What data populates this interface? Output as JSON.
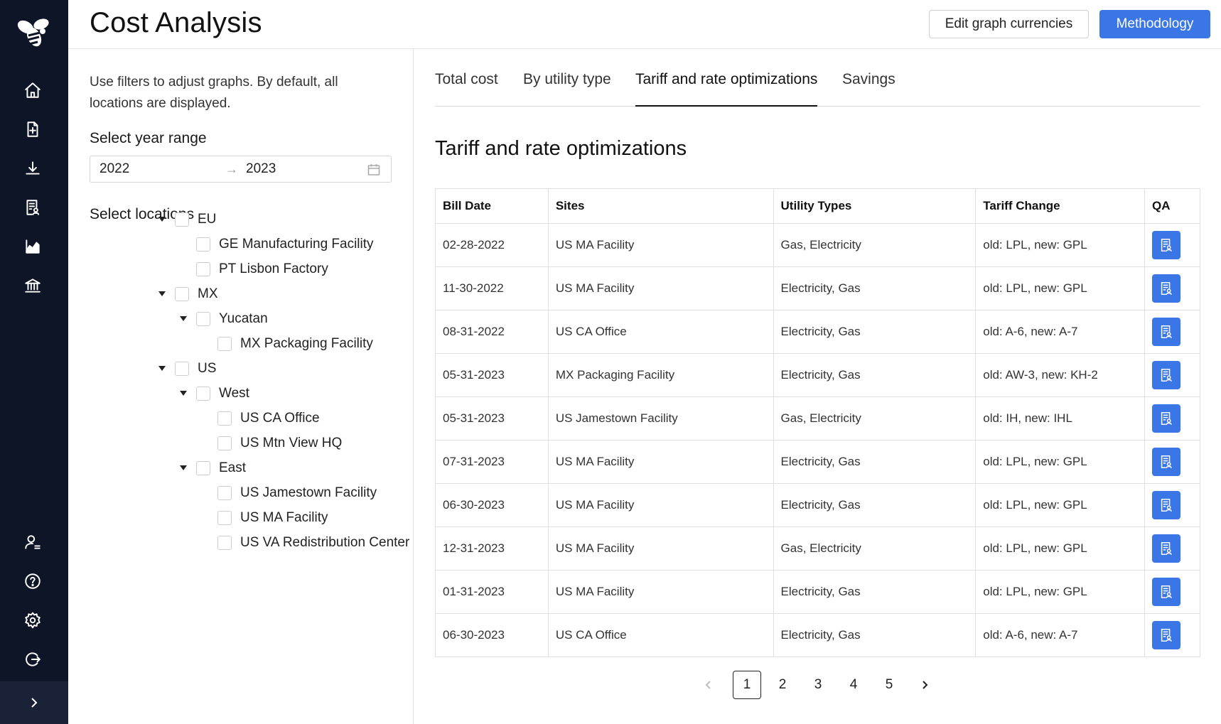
{
  "header": {
    "title": "Cost Analysis",
    "edit_currencies_label": "Edit graph currencies",
    "methodology_label": "Methodology"
  },
  "sidebar": {
    "icons": [
      "home-icon",
      "document-add-icon",
      "download-icon",
      "report-icon",
      "chart-icon",
      "bank-icon",
      "user-settings-icon",
      "help-icon",
      "settings-icon",
      "logout-icon"
    ],
    "expand_icon": "chevron-right-icon"
  },
  "filters": {
    "hint": "Use filters to adjust graphs. By default, all locations are displayed.",
    "year_range_label": "Select year range",
    "year_start": "2022",
    "year_arrow": "→",
    "year_end": "2023",
    "locations_label": "Select locations",
    "tree": [
      {
        "label": "EU",
        "level": 0,
        "expandable": true
      },
      {
        "label": "GE Manufacturing Facility",
        "level": 1,
        "expandable": false
      },
      {
        "label": "PT Lisbon Factory",
        "level": 1,
        "expandable": false
      },
      {
        "label": "MX",
        "level": 0,
        "expandable": true
      },
      {
        "label": "Yucatan",
        "level": 1,
        "expandable": true
      },
      {
        "label": "MX Packaging Facility",
        "level": 2,
        "expandable": false
      },
      {
        "label": "US",
        "level": 0,
        "expandable": true
      },
      {
        "label": "West",
        "level": 1,
        "expandable": true
      },
      {
        "label": "US CA Office",
        "level": 2,
        "expandable": false
      },
      {
        "label": "US Mtn View HQ",
        "level": 2,
        "expandable": false
      },
      {
        "label": "East",
        "level": 1,
        "expandable": true
      },
      {
        "label": "US Jamestown Facility",
        "level": 2,
        "expandable": false
      },
      {
        "label": "US MA Facility",
        "level": 2,
        "expandable": false
      },
      {
        "label": "US VA Redistribution Center",
        "level": 2,
        "expandable": false
      }
    ]
  },
  "tabs": [
    {
      "label": "Total cost"
    },
    {
      "label": "By utility type"
    },
    {
      "label": "Tariff and rate optimizations",
      "active": true
    },
    {
      "label": "Savings"
    }
  ],
  "main": {
    "section_title": "Tariff and rate optimizations",
    "columns": [
      "Bill Date",
      "Sites",
      "Utility Types",
      "Tariff Change",
      "QA"
    ],
    "rows": [
      [
        "02-28-2022",
        "US MA Facility",
        "Gas, Electricity",
        "old: LPL, new: GPL"
      ],
      [
        "11-30-2022",
        "US MA Facility",
        "Electricity, Gas",
        "old: LPL, new: GPL"
      ],
      [
        "08-31-2022",
        "US CA Office",
        "Electricity, Gas",
        "old: A-6, new: A-7"
      ],
      [
        "05-31-2023",
        "MX Packaging Facility",
        "Electricity, Gas",
        "old: AW-3, new: KH-2"
      ],
      [
        "05-31-2023",
        "US Jamestown Facility",
        "Gas, Electricity",
        "old: IH, new: IHL"
      ],
      [
        "07-31-2023",
        "US MA Facility",
        "Electricity, Gas",
        "old: LPL, new: GPL"
      ],
      [
        "06-30-2023",
        "US MA Facility",
        "Electricity, Gas",
        "old: LPL, new: GPL"
      ],
      [
        "12-31-2023",
        "US MA Facility",
        "Gas, Electricity",
        "old: LPL, new: GPL"
      ],
      [
        "01-31-2023",
        "US MA Facility",
        "Electricity, Gas",
        "old: LPL, new: GPL"
      ],
      [
        "06-30-2023",
        "US CA Office",
        "Electricity, Gas",
        "old: A-6, new: A-7"
      ]
    ],
    "qa_icon": "report-icon"
  },
  "pagination": {
    "pages": [
      "1",
      "2",
      "3",
      "4",
      "5"
    ],
    "current": "1"
  },
  "colors": {
    "sidebar_bg": "#0e1526",
    "accent": "#3a76e6"
  }
}
